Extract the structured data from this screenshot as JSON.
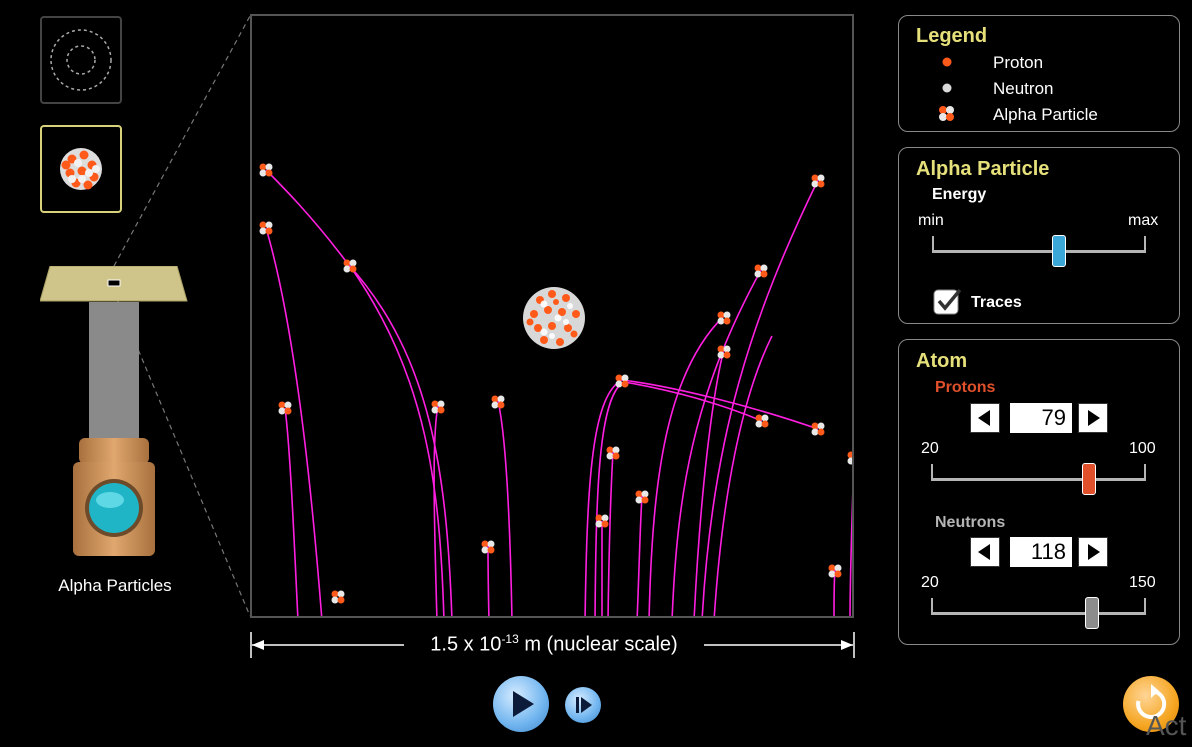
{
  "view": {
    "scale_prefix": "1.5 x 10",
    "scale_exponent": "-13",
    "scale_suffix": " m (nuclear scale)"
  },
  "gun": {
    "caption": "Alpha Particles"
  },
  "legend": {
    "title": "Legend",
    "items": [
      "Proton",
      "Neutron",
      "Alpha Particle"
    ]
  },
  "alpha_particle": {
    "title": "Alpha Particle",
    "energy_label": "Energy",
    "min_label": "min",
    "max_label": "max",
    "energy_level": 0.6,
    "traces_label": "Traces",
    "traces_checked": true
  },
  "atom": {
    "title": "Atom",
    "protons_label": "Protons",
    "protons_value": "79",
    "protons_min": "20",
    "protons_max": "100",
    "neutrons_label": "Neutrons",
    "neutrons_value": "118",
    "neutrons_min": "20",
    "neutrons_max": "150"
  },
  "corner_text": "Act",
  "colors": {
    "proton": "#ff5a1a",
    "neutron": "#d9d9d9",
    "trace": "#ff1fe0",
    "panel_title": "#e6e07a",
    "protons_label": "#e0502a",
    "energy_knob": "#3aa7d8",
    "protons_knob": "#e0502a",
    "neutrons_knob": "#8c8c8c"
  },
  "icons": [
    "atom-orbit-icon",
    "nucleus-icon",
    "play-icon",
    "step-icon",
    "reset-icon",
    "checkbox-icon"
  ]
}
